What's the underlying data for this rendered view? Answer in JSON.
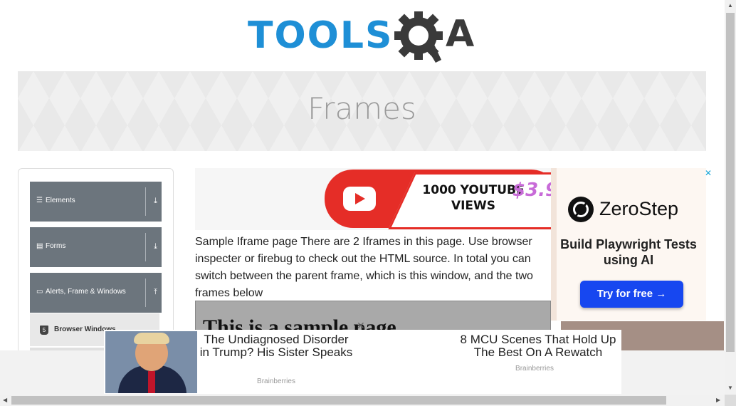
{
  "logo": {
    "text_left": "TOOLS",
    "text_right": "QA"
  },
  "banner": {
    "title": "Frames"
  },
  "sidebar": {
    "groups": [
      {
        "label": "Elements",
        "icon": "hamburger-icon",
        "toggle": "⤓"
      },
      {
        "label": "Forms",
        "icon": "list-icon",
        "toggle": "⤓"
      },
      {
        "label": "Alerts, Frame & Windows",
        "icon": "window-icon",
        "toggle": "⤒"
      }
    ],
    "subitems": [
      {
        "label": "Browser Windows",
        "icon": "html5-icon",
        "icon_text": "5"
      }
    ]
  },
  "ad_top": {
    "headline": "1000 YOUTUBE VIEWS",
    "price": "$3.9"
  },
  "content": {
    "description": "Sample Iframe page There are 2 Iframes in this page. Use browser inspecter or firebug to check out the HTML source. In total you can switch between the parent frame, which is this window, and the two frames below",
    "frame_heading": "This is a sample page",
    "frame_close": "✕"
  },
  "ad_right": {
    "brand": "ZeroStep",
    "description": "Build Playwright Tests using AI",
    "cta": "Try for free →",
    "corner": "✕",
    "accent": "#1747f0"
  },
  "ad_bottom": {
    "items": [
      {
        "headline": "The Undiagnosed Disorder in Trump? His Sister Speaks",
        "source": "Brainberries"
      },
      {
        "headline": "8 MCU Scenes That Hold Up The Best On A Rewatch",
        "source": "Brainberries"
      }
    ]
  },
  "scrollbars": {
    "up": "▲",
    "down": "▼",
    "left": "◀",
    "right": "▶"
  },
  "colors": {
    "logo_blue": "#1e8fd6",
    "sidebar_group": "#6c757d",
    "youtube_red": "#e52d27"
  }
}
